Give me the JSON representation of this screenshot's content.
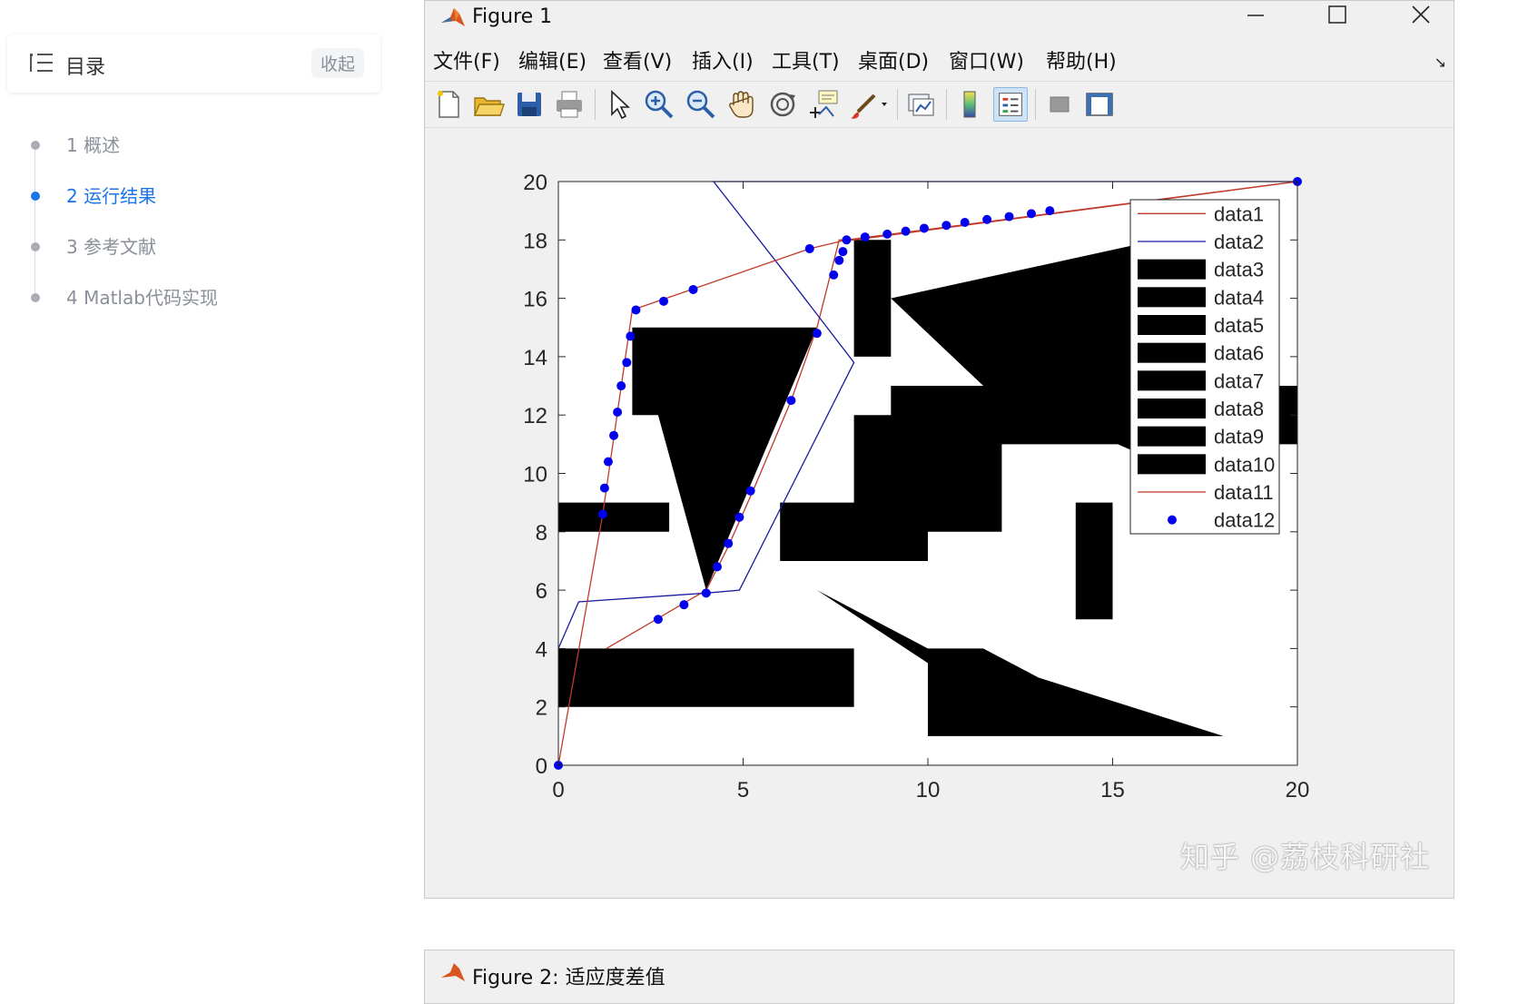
{
  "toc": {
    "title": "目录",
    "collapse_label": "收起",
    "items": [
      {
        "label": "1 概述",
        "active": false
      },
      {
        "label": "2 运行结果",
        "active": true
      },
      {
        "label": "3 参考文献",
        "active": false
      },
      {
        "label": "4 Matlab代码实现",
        "active": false
      }
    ]
  },
  "figure_window": {
    "title": "Figure 1",
    "menu": [
      "文件(F)",
      "编辑(E)",
      "查看(V)",
      "插入(I)",
      "工具(T)",
      "桌面(D)",
      "窗口(W)",
      "帮助(H)"
    ],
    "toolbar_icons": [
      "new-figure-icon",
      "open-file-icon",
      "save-icon",
      "print-icon",
      "select-arrow-icon",
      "zoom-in-icon",
      "zoom-out-icon",
      "pan-hand-icon",
      "rotate-3d-icon",
      "data-cursor-icon",
      "brush-icon",
      "link-plot-icon",
      "colorbar-icon",
      "legend-icon",
      "hide-plot-tools-icon",
      "show-plot-tools-icon"
    ]
  },
  "second_window": {
    "title": "Figure 2: 适应度差值"
  },
  "watermark": "知乎 @荔枝科研社",
  "chart_data": {
    "type": "line",
    "xlim": [
      0,
      20
    ],
    "ylim": [
      0,
      20
    ],
    "xticks": [
      0,
      5,
      10,
      15,
      20
    ],
    "yticks": [
      0,
      2,
      4,
      6,
      8,
      10,
      12,
      14,
      16,
      18,
      20
    ],
    "grid": false,
    "legend_position": "top-right",
    "colors": {
      "red": "#c0392b",
      "blue": "#1a1aa0",
      "obstacle": "#000000",
      "marker": "#0000ee"
    },
    "series": [
      {
        "name": "data1",
        "kind": "line",
        "color": "#c0392b",
        "points": [
          [
            1.3,
            4.0
          ],
          [
            4.0,
            6.0
          ],
          [
            4.6,
            7.5
          ],
          [
            5.3,
            9.5
          ],
          [
            6.3,
            12.5
          ],
          [
            7.0,
            15.0
          ],
          [
            7.6,
            18.0
          ],
          [
            8.0,
            18.0
          ],
          [
            20,
            20
          ]
        ]
      },
      {
        "name": "data2",
        "kind": "line",
        "color": "#1a1aa0",
        "points": [
          [
            0,
            4.0
          ],
          [
            0.55,
            5.6
          ],
          [
            4.0,
            5.9
          ],
          [
            4.9,
            6.0
          ],
          [
            8.0,
            13.8
          ],
          [
            6.3,
            16.6
          ],
          [
            4.2,
            20.0
          ],
          [
            20,
            20
          ]
        ]
      },
      {
        "name": "data3",
        "kind": "polygon",
        "points": [
          [
            0,
            2
          ],
          [
            8,
            2
          ],
          [
            8,
            4
          ],
          [
            0,
            4
          ]
        ]
      },
      {
        "name": "data4",
        "kind": "polygon",
        "points": [
          [
            0,
            8
          ],
          [
            3,
            8
          ],
          [
            3,
            9
          ],
          [
            0,
            9
          ]
        ]
      },
      {
        "name": "data5",
        "kind": "polygon",
        "points": [
          [
            2,
            12
          ],
          [
            2,
            15
          ],
          [
            7,
            15
          ],
          [
            4,
            6
          ],
          [
            2.7,
            12
          ]
        ]
      },
      {
        "name": "data6",
        "kind": "polygon",
        "points": [
          [
            8,
            14
          ],
          [
            9,
            14
          ],
          [
            9,
            18
          ],
          [
            8,
            18
          ]
        ]
      },
      {
        "name": "data7",
        "kind": "polygon",
        "points": [
          [
            6,
            7
          ],
          [
            10,
            7
          ],
          [
            10,
            8
          ],
          [
            12,
            8
          ],
          [
            12,
            11
          ],
          [
            20,
            11
          ],
          [
            20,
            13
          ],
          [
            9,
            13
          ],
          [
            9,
            12
          ],
          [
            8,
            12
          ],
          [
            8,
            9
          ],
          [
            6,
            9
          ]
        ]
      },
      {
        "name": "data8",
        "kind": "polygon",
        "points": [
          [
            9,
            16
          ],
          [
            15.5,
            17.8
          ],
          [
            15.5,
            10.8
          ],
          [
            11.5,
            13
          ]
        ]
      },
      {
        "name": "data9",
        "kind": "polygon",
        "points": [
          [
            14,
            5
          ],
          [
            15,
            5
          ],
          [
            15,
            9
          ],
          [
            14,
            9
          ]
        ]
      },
      {
        "name": "data10",
        "kind": "polygon",
        "points": [
          [
            7,
            6
          ],
          [
            10,
            4
          ],
          [
            11.5,
            4
          ],
          [
            13,
            3
          ],
          [
            18,
            1
          ],
          [
            13,
            1
          ],
          [
            10,
            1
          ],
          [
            10,
            3.5
          ]
        ]
      },
      {
        "name": "data11",
        "kind": "line",
        "color": "#c0392b",
        "points": [
          [
            0,
            0
          ],
          [
            1.2,
            8.6
          ],
          [
            2.0,
            15.6
          ],
          [
            3.6,
            16.3
          ],
          [
            6.8,
            17.7
          ],
          [
            7.8,
            18.0
          ],
          [
            20,
            20
          ]
        ]
      },
      {
        "name": "data12",
        "kind": "markers",
        "color": "#0000ee",
        "points": [
          [
            0,
            0
          ],
          [
            1.2,
            8.6
          ],
          [
            1.25,
            9.5
          ],
          [
            1.35,
            10.4
          ],
          [
            1.5,
            11.3
          ],
          [
            1.6,
            12.1
          ],
          [
            1.7,
            13.0
          ],
          [
            1.85,
            13.8
          ],
          [
            1.95,
            14.7
          ],
          [
            2.1,
            15.6
          ],
          [
            2.85,
            15.9
          ],
          [
            3.65,
            16.3
          ],
          [
            6.8,
            17.7
          ],
          [
            7.8,
            18.0
          ],
          [
            8.3,
            18.1
          ],
          [
            8.9,
            18.2
          ],
          [
            9.4,
            18.3
          ],
          [
            9.9,
            18.4
          ],
          [
            10.5,
            18.5
          ],
          [
            11.0,
            18.6
          ],
          [
            11.6,
            18.7
          ],
          [
            12.2,
            18.8
          ],
          [
            12.8,
            18.9
          ],
          [
            13.3,
            19.0
          ],
          [
            20,
            20
          ],
          [
            2.7,
            5.0
          ],
          [
            3.4,
            5.5
          ],
          [
            4.0,
            5.9
          ],
          [
            4.3,
            6.8
          ],
          [
            4.6,
            7.6
          ],
          [
            4.9,
            8.5
          ],
          [
            5.2,
            9.4
          ],
          [
            6.3,
            12.5
          ],
          [
            7.0,
            14.8
          ],
          [
            7.45,
            16.8
          ],
          [
            7.6,
            17.3
          ],
          [
            7.7,
            17.6
          ]
        ]
      }
    ]
  }
}
